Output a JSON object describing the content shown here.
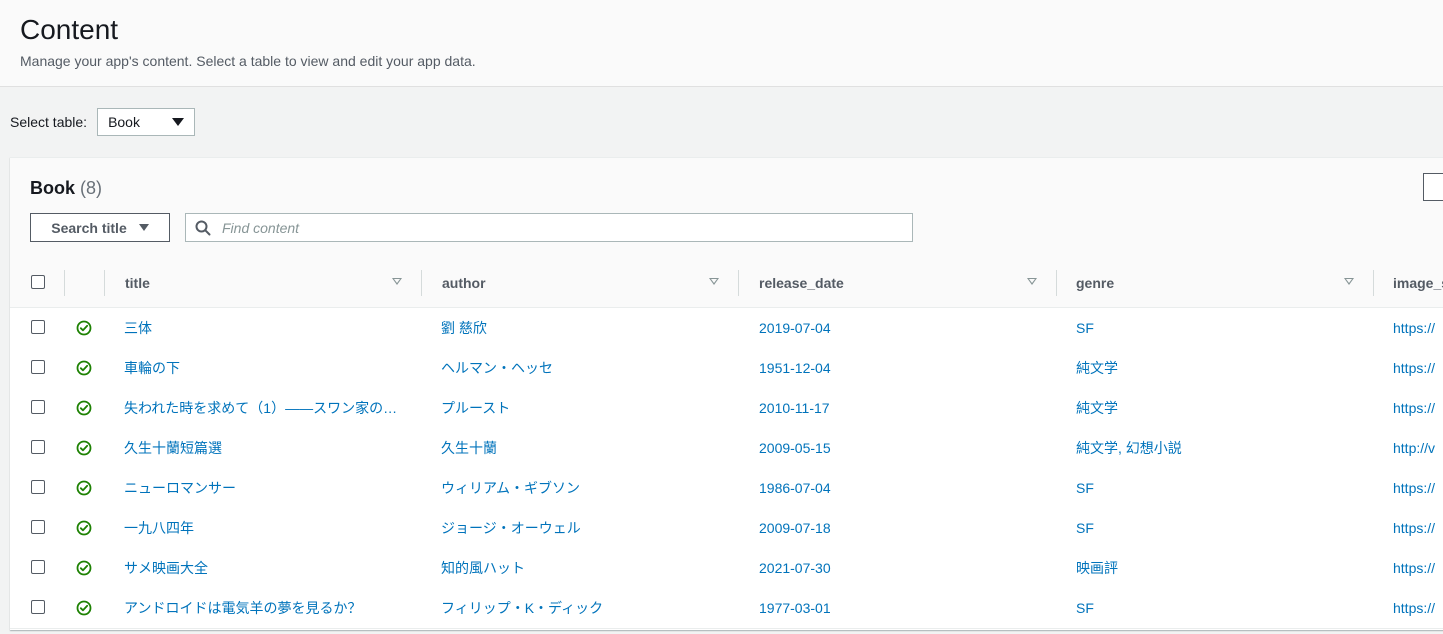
{
  "header": {
    "title": "Content",
    "subtitle": "Manage your app's content. Select a table to view and edit your app data."
  },
  "table_select": {
    "label": "Select table:",
    "value": "Book"
  },
  "panel": {
    "title": "Book",
    "count": "(8)",
    "search_button_label": "Search title",
    "search_placeholder": "Find content"
  },
  "columns": {
    "title": "title",
    "author": "author",
    "release_date": "release_date",
    "genre": "genre",
    "image": "image_s"
  },
  "rows": [
    {
      "title": "三体",
      "author": "劉 慈欣",
      "release_date": "2019-07-04",
      "genre": "SF",
      "image": "https://"
    },
    {
      "title": "車輪の下",
      "author": "ヘルマン・ヘッセ",
      "release_date": "1951-12-04",
      "genre": "純文学",
      "image": "https://"
    },
    {
      "title": "失われた時を求めて（1）――スワン家の…",
      "author": "プルースト",
      "release_date": "2010-11-17",
      "genre": "純文学",
      "image": "https://"
    },
    {
      "title": "久生十蘭短篇選",
      "author": "久生十蘭",
      "release_date": "2009-05-15",
      "genre": "純文学, 幻想小説",
      "image": "http://v"
    },
    {
      "title": "ニューロマンサー",
      "author": "ウィリアム・ギブソン",
      "release_date": "1986-07-04",
      "genre": "SF",
      "image": "https://"
    },
    {
      "title": "一九八四年",
      "author": "ジョージ・オーウェル",
      "release_date": "2009-07-18",
      "genre": "SF",
      "image": "https://"
    },
    {
      "title": "サメ映画大全",
      "author": "知的風ハット",
      "release_date": "2021-07-30",
      "genre": "映画評",
      "image": "https://"
    },
    {
      "title": "アンドロイドは電気羊の夢を見るか？",
      "author": "フィリップ・K・ディック",
      "release_date": "1977-03-01",
      "genre": "SF",
      "image": "https://"
    }
  ],
  "icons": {
    "status": "check-circle-icon",
    "search": "search-icon",
    "sort": "sort-caret-icon",
    "dropdown": "caret-down-icon"
  },
  "colors": {
    "link": "#0073bb",
    "success": "#1d8102",
    "header_bg": "#fafafa",
    "page_bg": "#f2f3f3"
  }
}
